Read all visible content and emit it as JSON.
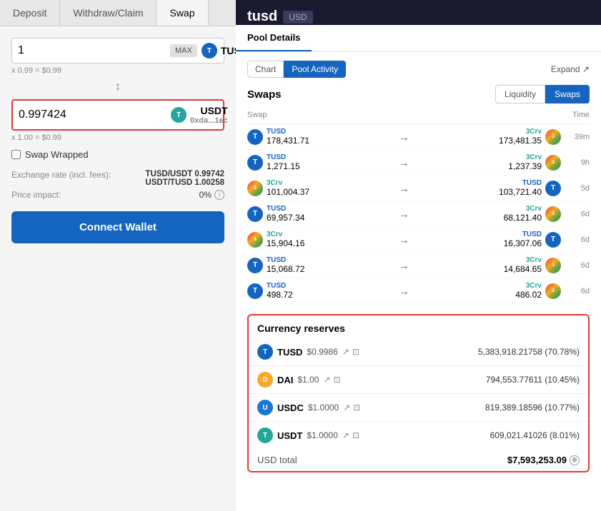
{
  "left": {
    "tabs": [
      {
        "label": "Deposit",
        "active": false
      },
      {
        "label": "Withdraw/Claim",
        "active": false
      },
      {
        "label": "Swap",
        "active": true
      }
    ],
    "from_amount": "1",
    "from_token": "TUSD",
    "from_equiv": "x 0.99 = $0.99",
    "to_amount": "0.997424",
    "to_token": "USDT",
    "to_address": "0xda...1ec",
    "to_equiv": "x 1.00 = $0.99",
    "swap_wrapped_label": "Swap Wrapped",
    "exchange_rate_label": "Exchange rate (incl. fees):",
    "exchange_rate_1": "TUSD/USDT 0.99742",
    "exchange_rate_2": "USDT/TUSD 1.00258",
    "price_impact_label": "Price impact:",
    "price_impact_value": "0%",
    "connect_wallet_label": "Connect Wallet"
  },
  "right": {
    "pool_title": "tusd",
    "pool_badge": "USD",
    "pool_tabs": [
      {
        "label": "Pool Details",
        "active": true
      }
    ],
    "chart_buttons": [
      {
        "label": "Chart",
        "active": false
      },
      {
        "label": "Pool Activity",
        "active": true
      }
    ],
    "expand_label": "Expand ↗",
    "swaps_title": "Swaps",
    "liquidity_swaps_buttons": [
      {
        "label": "Liquidity",
        "active": false
      },
      {
        "label": "Swaps",
        "active": true
      }
    ],
    "table_headers": {
      "swap": "Swap",
      "time": "Time"
    },
    "swap_rows": [
      {
        "from_token": "TUSD",
        "from_amount": "178,431.71",
        "to_token": "3Crv",
        "to_amount": "173,481.35",
        "time": "39m"
      },
      {
        "from_token": "TUSD",
        "from_amount": "1,271.15",
        "to_token": "3Crv",
        "to_amount": "1,237.39",
        "time": "9h"
      },
      {
        "from_token": "3Crv",
        "from_amount": "101,004.37",
        "to_token": "TUSD",
        "to_amount": "103,721.40",
        "time": "5d"
      },
      {
        "from_token": "TUSD",
        "from_amount": "69,957.34",
        "to_token": "3Crv",
        "to_amount": "68,121.40",
        "time": "6d"
      },
      {
        "from_token": "3Crv",
        "from_amount": "15,904.16",
        "to_token": "TUSD",
        "to_amount": "16,307.06",
        "time": "6d"
      },
      {
        "from_token": "TUSD",
        "from_amount": "15,068.72",
        "to_token": "3Crv",
        "to_amount": "14,684.65",
        "time": "6d"
      },
      {
        "from_token": "TUSD",
        "from_amount": "498.72",
        "to_token": "3Crv",
        "to_amount": "486.02",
        "time": "6d"
      }
    ],
    "currency_reserves_title": "Currency reserves",
    "reserves": [
      {
        "token": "TUSD",
        "type": "tusd",
        "price": "$0.9986",
        "amount": "5,383,918.21758 (70.78%)"
      },
      {
        "token": "DAI",
        "type": "dai",
        "price": "$1.00",
        "amount": "794,553.77611 (10.45%)"
      },
      {
        "token": "USDC",
        "type": "usdc",
        "price": "$1.0000",
        "amount": "819,389.18596 (10.77%)"
      },
      {
        "token": "USDT",
        "type": "usdt",
        "price": "$1.0000",
        "amount": "609,021.41026 (8.01%)"
      }
    ],
    "usd_total_label": "USD total",
    "usd_total_value": "$7,593,253.09"
  }
}
